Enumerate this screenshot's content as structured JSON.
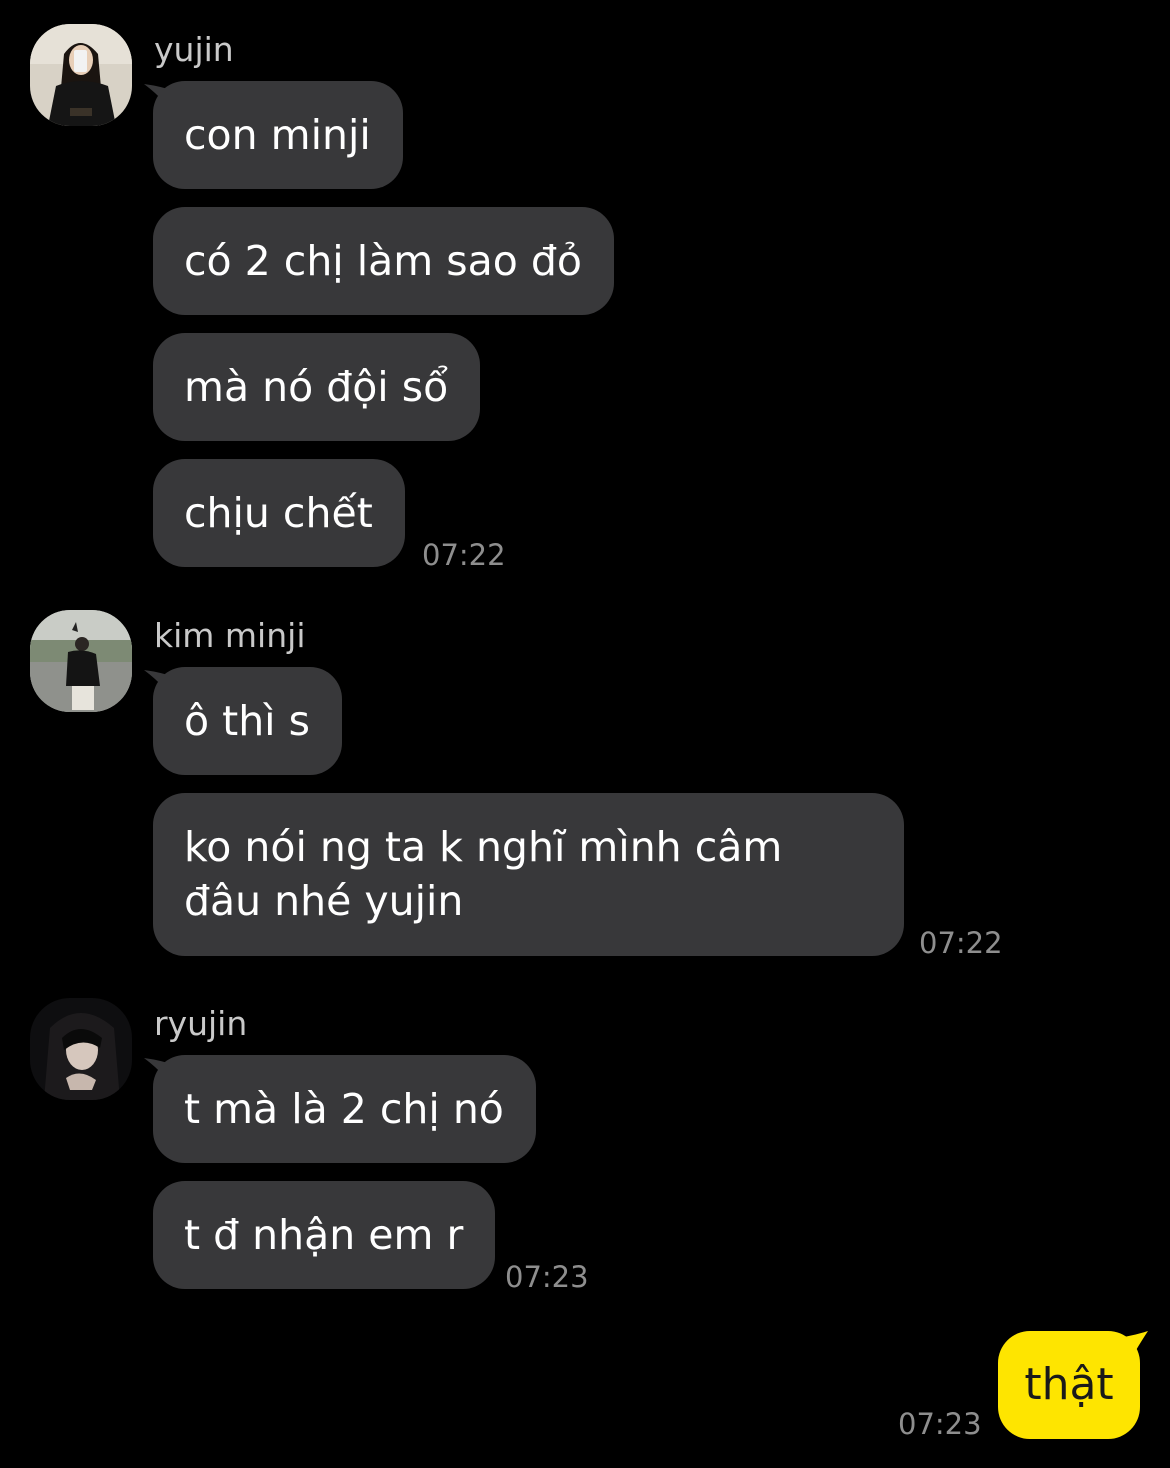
{
  "colors": {
    "background": "#000000",
    "incoming_bubble": "#38383a",
    "outgoing_bubble": "#fee500",
    "sender_text": "#c9c9c9",
    "timestamp_text": "#8e8e8e"
  },
  "messages": [
    {
      "sender": "yujin",
      "avatar": "profile-photo-icon",
      "bubbles": [
        "con minji",
        "có 2 chị làm sao đỏ",
        "mà nó đội sổ",
        "chịu chết"
      ],
      "time": "07:22"
    },
    {
      "sender": "kim minji",
      "avatar": "profile-photo-icon",
      "bubbles": [
        "ô thì s",
        "ko nói ng ta k nghĩ mình câm đâu nhé yujin"
      ],
      "time": "07:22"
    },
    {
      "sender": "ryujin",
      "avatar": "profile-photo-icon",
      "bubbles": [
        "t mà là 2 chị nó",
        "t đ nhận em r"
      ],
      "time": "07:23"
    }
  ],
  "outgoing": {
    "text": "thật",
    "time": "07:23"
  }
}
